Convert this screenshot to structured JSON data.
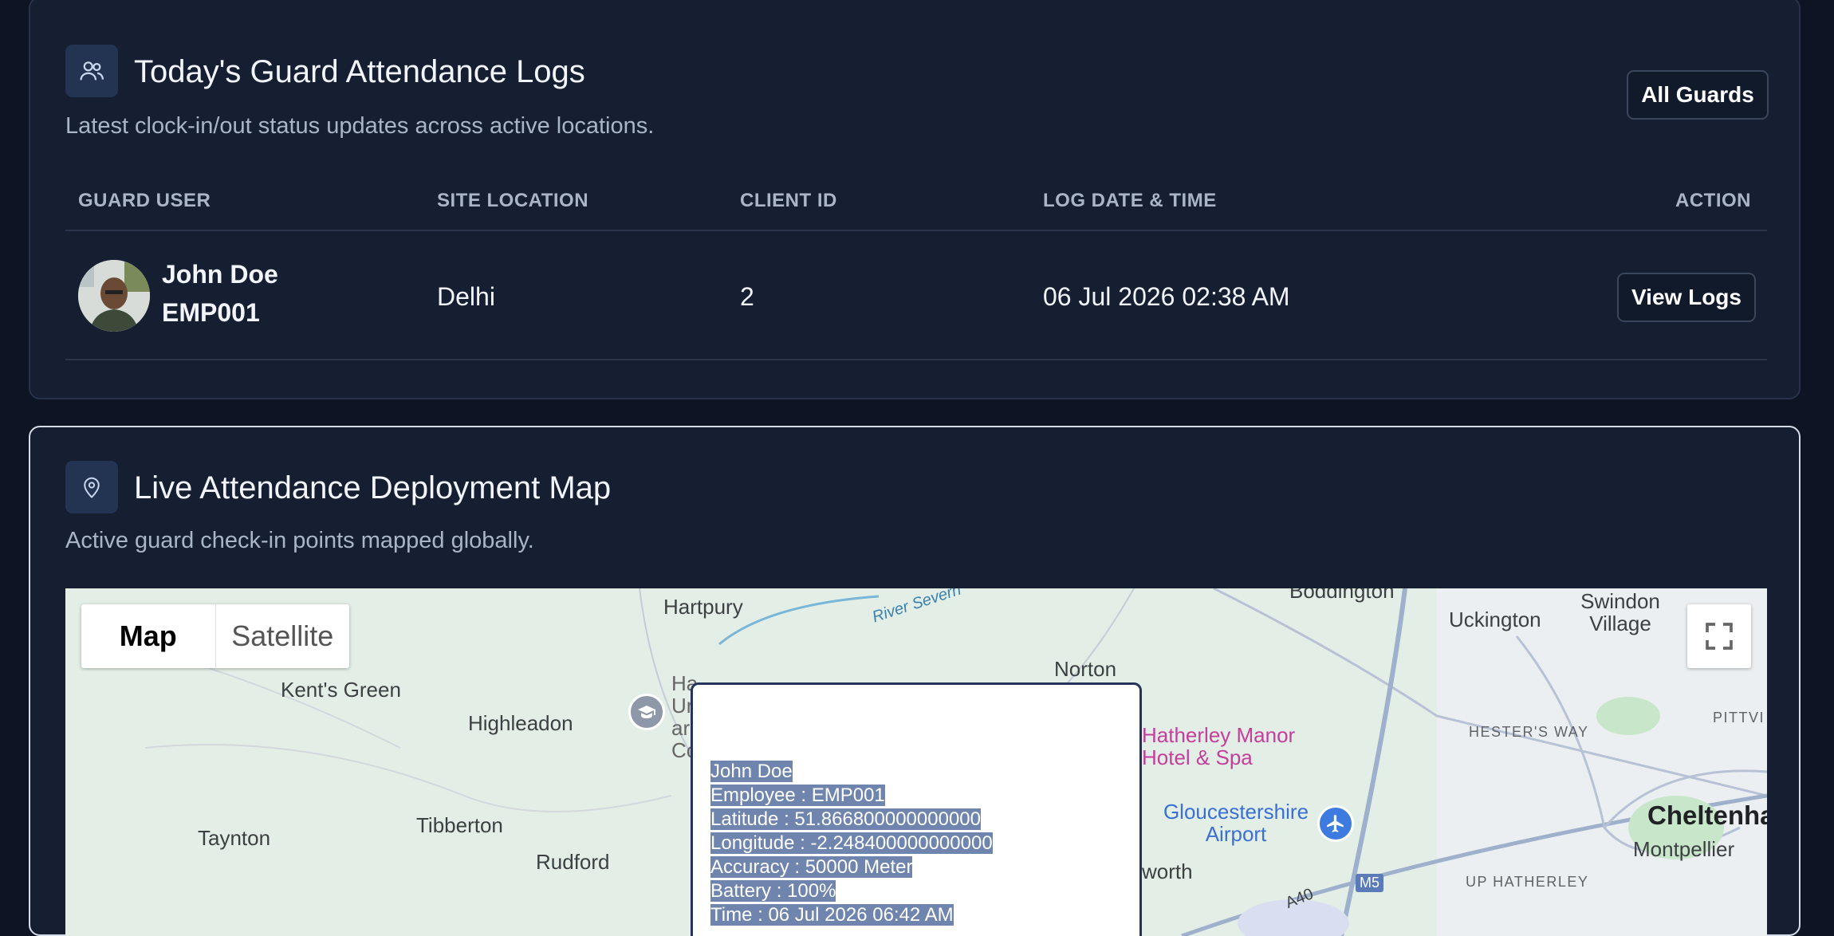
{
  "logs": {
    "title": "Today's Guard Attendance Logs",
    "subtitle": "Latest clock-in/out status updates across active locations.",
    "all_guards_label": "All Guards",
    "columns": [
      "GUARD USER",
      "SITE LOCATION",
      "CLIENT ID",
      "LOG DATE & TIME",
      "ACTION"
    ],
    "rows": [
      {
        "name": "John Doe",
        "employee_id": "EMP001",
        "site": "Delhi",
        "client_id": "2",
        "datetime": "06 Jul 2026 02:38 AM",
        "action_label": "View Logs"
      }
    ]
  },
  "map_section": {
    "title": "Live Attendance Deployment Map",
    "subtitle": "Active guard check-in points mapped globally.",
    "map_types": [
      "Map",
      "Satellite"
    ],
    "selected_map_type": "Map",
    "fullscreen_icon": "fullscreen-icon",
    "places": [
      "Hartpury",
      "Kent's Green",
      "Highleadon",
      "Tibberton",
      "Taynton",
      "Rudford",
      "Norton",
      "Boddington",
      "Uckington",
      "Swindon Village",
      "HESTER'S WAY",
      "PITTVI",
      "Cheltenha",
      "Montpellier",
      "UP HATHERLEY",
      "Hatherley Manor Hotel & Spa",
      "Gloucestershire Airport",
      "River Severn",
      "A40",
      "M5",
      "worth",
      "Ha",
      "Ur",
      "ar",
      "Co"
    ],
    "info_window": {
      "name": "John Doe",
      "employee": "Employee : EMP001",
      "latitude": "Latitude : 51.866800000000000",
      "longitude": "Longitude : -2.248400000000000",
      "accuracy": "Accuracy : 50000 Meter",
      "battery": "Battery : 100%",
      "time": "Time : 06 Jul 2026 06:42 AM"
    }
  },
  "colors": {
    "background": "#0d1423",
    "card": "#161f31",
    "accent_icon_bg": "#233352"
  }
}
